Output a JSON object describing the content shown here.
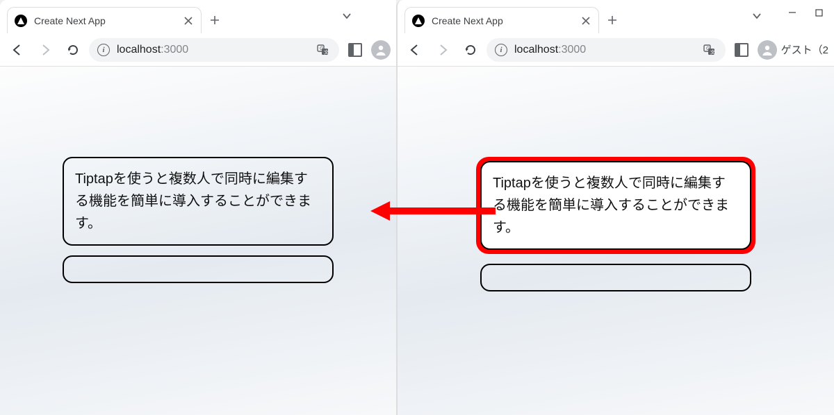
{
  "tab": {
    "title": "Create Next App"
  },
  "url": {
    "host": "localhost",
    "port": ":3000"
  },
  "editor_text": "Tiptapを使うと複数人で同時に編集する機能を簡単に導入することができます。",
  "right_toolbar": {
    "guest_label": "ゲスト（2"
  },
  "arrow_color": "#ff0000",
  "highlight_color": "#ff0000"
}
